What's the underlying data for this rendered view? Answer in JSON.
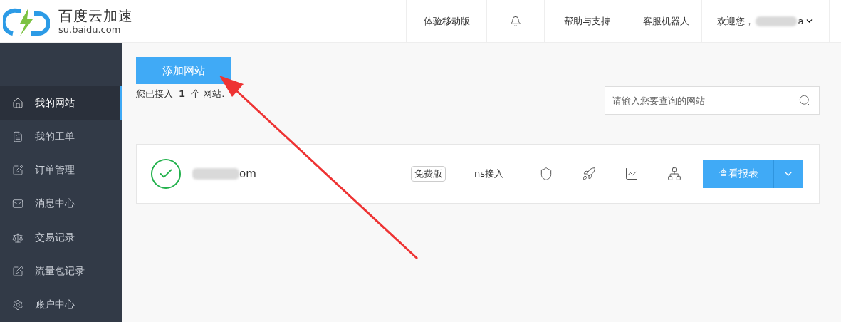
{
  "logo": {
    "title": "百度云加速",
    "subtitle": "su.baidu.com"
  },
  "header_nav": [
    {
      "kind": "text",
      "label": "体验移动版"
    },
    {
      "kind": "bell"
    },
    {
      "kind": "text",
      "label": "帮助与支持"
    },
    {
      "kind": "text",
      "label": "客服机器人"
    }
  ],
  "user": {
    "greeting": "欢迎您，",
    "name_tail": "a"
  },
  "sidebar": {
    "items": [
      {
        "label": "我的网站",
        "selected": true
      },
      {
        "label": "我的工单",
        "selected": false
      },
      {
        "label": "订单管理",
        "selected": false
      },
      {
        "label": "消息中心",
        "selected": false
      },
      {
        "label": "交易记录",
        "selected": false
      },
      {
        "label": "流量包记录",
        "selected": false
      },
      {
        "label": "账户中心",
        "selected": false
      }
    ]
  },
  "main": {
    "add_button": "添加网站",
    "summary": {
      "prefix": "您已接入",
      "count": "1",
      "suffix": "个 网站."
    },
    "search": {
      "placeholder": "请输入您要查询的网站"
    },
    "sites": [
      {
        "domain_tail": "om",
        "verified": true,
        "plan": "免费版",
        "access": "ns接入",
        "report_button": "查看报表"
      }
    ]
  }
}
